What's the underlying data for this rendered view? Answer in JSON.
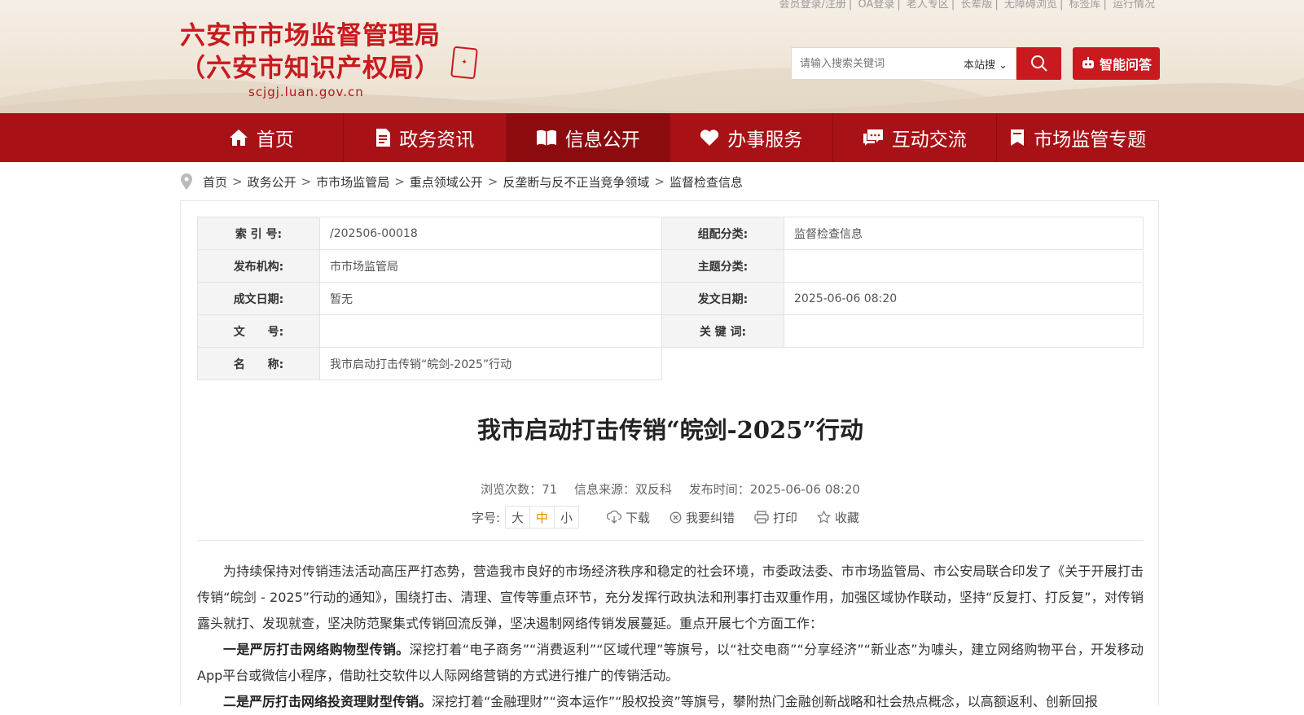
{
  "header": {
    "title_line1": "六安市市场监督管理局",
    "title_line2": "（六安市知识产权局）",
    "url": "scjgj.luan.gov.cn",
    "top_links": [
      "会员登录/注册",
      "OA登录",
      "老人专区",
      "长辈版",
      "无障碍浏览",
      "标签库",
      "运行情况"
    ],
    "search_placeholder": "请输入搜索关键词",
    "search_scope": "本站搜",
    "ai_label": "智能问答"
  },
  "nav": {
    "items": [
      {
        "label": "首页"
      },
      {
        "label": "政务资讯"
      },
      {
        "label": "信息公开"
      },
      {
        "label": "办事服务"
      },
      {
        "label": "互动交流"
      },
      {
        "label": "市场监管专题"
      }
    ]
  },
  "breadcrumb": [
    "首页",
    "政务公开",
    "市市场监管局",
    "重点领域公开",
    "反垄断与反不正当竞争领域",
    "监督检查信息"
  ],
  "meta": {
    "index_label": "索 引 号:",
    "index_value": "/202506-00018",
    "category_label": "组配分类:",
    "category_value": "监督检查信息",
    "publisher_label": "发布机构:",
    "publisher_value": "市市场监管局",
    "topic_label": "主题分类:",
    "topic_value": "",
    "created_label": "成文日期:",
    "created_value": "暂无",
    "issued_label": "发文日期:",
    "issued_value": "2025-06-06 08:20",
    "docno_label": "文　　号:",
    "docno_value": "",
    "keywords_label": "关 键 词:",
    "keywords_value": "",
    "name_label": "名　　称:",
    "name_value": "我市启动打击传销“皖剑-2025”行动"
  },
  "article": {
    "title": "我市启动打击传销“皖剑-2025”行动",
    "views": "浏览次数：71",
    "source": "信息来源：双反科",
    "time": "发布时间：2025-06-06 08:20",
    "font_label": "字号:",
    "font_sizes": [
      "大",
      "中",
      "小"
    ],
    "download": "下载",
    "correct": "我要纠错",
    "print": "打印",
    "favorite": "收藏",
    "p1": "为持续保持对传销违法活动高压严打态势，营造我市良好的市场经济秩序和稳定的社会环境，市委政法委、市市场监管局、市公安局联合印发了《关于开展打击传销“皖剑 - 2025”行动的通知》，围绕打击、清理、宣传等重点环节，充分发挥行政执法和刑事打击双重作用，加强区域协作联动，坚持“反复打、打反复”，对传销露头就打、发现就查，坚决防范聚集式传销回流反弹，坚决遏制网络传销发展蔓延。重点开展七个方面工作：",
    "p2_bold": "一是严厉打击网络购物型传销。",
    "p2_text": "深挖打着“电子商务”“消费返利”“区域代理”等旗号，以“社交电商”“分享经济”“新业态”为噱头，建立网络购物平台，开发移动App平台或微信小程序，借助社交软件以人际网络营销的方式进行推广的传销活动。",
    "p3_bold": "二是严厉打击网络投资理财型传销。",
    "p3_text": "深挖打着“金融理财”“资本运作”“股权投资”等旗号，攀附热门金融创新战略和社会热点概念，以高额返利、创新回报"
  },
  "colors": {
    "brand_red": "#c81a1f",
    "nav_red": "#a81116"
  }
}
